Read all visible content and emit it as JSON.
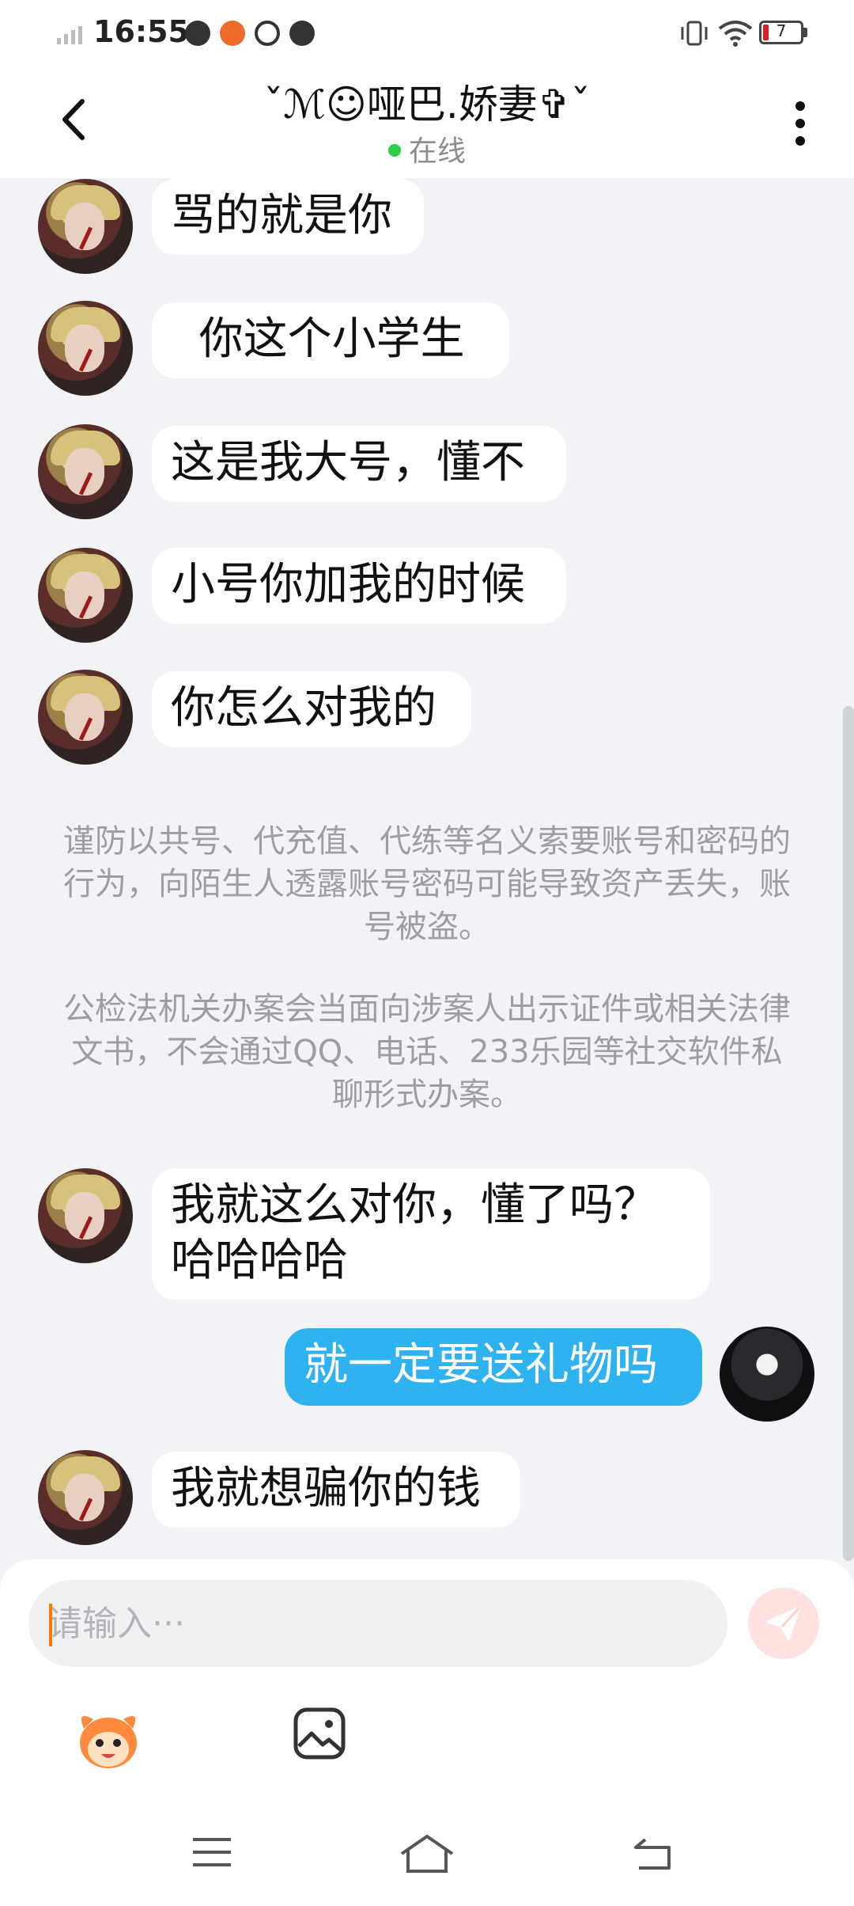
{
  "status_bar": {
    "time": "16:55",
    "battery": "7"
  },
  "header": {
    "title": "ˇℳ☺哑巴.娇妻✞ˇ",
    "status": "在线"
  },
  "messages": [
    {
      "direction": "in",
      "text": "骂的就是你"
    },
    {
      "direction": "in",
      "text": "  你这个小学生"
    },
    {
      "direction": "in",
      "text": "这是我大号，懂不"
    },
    {
      "direction": "in",
      "text": "小号你加我的时候"
    },
    {
      "direction": "in",
      "text": "你怎么对我的"
    },
    {
      "direction": "in",
      "text": "我就这么对你，懂了吗？\n哈哈哈哈"
    },
    {
      "direction": "out",
      "text": "就一定要送礼物吗"
    },
    {
      "direction": "in",
      "text": "我就想骗你的钱"
    }
  ],
  "notices": [
    "谨防以共号、代充值、代练等名义索要账号和密码的行为，向陌生人透露账号密码可能导致资产丢失，账号被盗。",
    "公检法机关办案会当面向涉案人出示证件或相关法律文书，不会通过QQ、电话、233乐园等社交软件私聊形式办案。"
  ],
  "input": {
    "placeholder": "请输入···",
    "value": ""
  },
  "icons": {
    "back": "back-arrow-icon",
    "more": "more-vertical-icon",
    "send": "send-icon",
    "emoji": "mascot-emoji-icon",
    "image": "image-icon",
    "menu": "menu-icon",
    "home": "home-icon",
    "nav_back": "back-nav-icon"
  },
  "colors": {
    "background": "#f1f3f7",
    "outgoing_bubble": "#2fb3f0",
    "incoming_bubble": "#ffffff",
    "online": "#2bcf4a",
    "caret": "#ff7a00",
    "send_bg": "#ffe2e0"
  }
}
